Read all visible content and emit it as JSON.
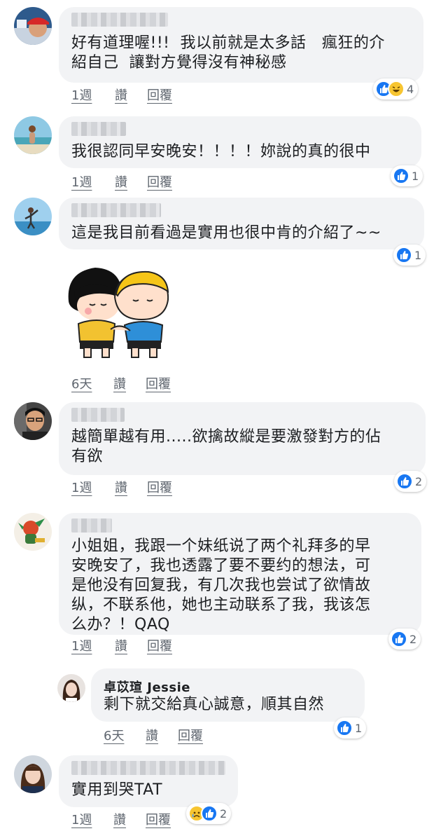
{
  "comments": [
    {
      "text": "好有道理喔!!!  我以前就是太多話   瘋狂的介\n紹自己  讓對方覺得沒有神秘感",
      "time": "1週",
      "like": "讚",
      "reply": "回覆",
      "reaction_count": "4",
      "reactions": [
        "like-icon",
        "laugh-icon"
      ]
    },
    {
      "text": "我很認同早安晚安！！！！妳說的真的很中",
      "time": "1週",
      "like": "讚",
      "reply": "回覆",
      "reaction_count": "1",
      "reactions": [
        "like-icon"
      ]
    },
    {
      "text": "這是我目前看過是實用也很中肯的介紹了~~",
      "reaction_count": "1",
      "reactions": [
        "like-icon"
      ]
    },
    {
      "sticker": "hugging-kids-sticker",
      "time": "6天",
      "like": "讚",
      "reply": "回覆"
    },
    {
      "text": "越簡單越有用.....欲擒故縱是要激發對方的佔\n有欲",
      "time": "1週",
      "like": "讚",
      "reply": "回覆",
      "reaction_count": "2",
      "reactions": [
        "like-icon"
      ]
    },
    {
      "text": "小姐姐，我跟一个妹纸说了两个礼拜多的早\n安晚安了，我也透露了要不要约的想法，可\n是他没有回复我，有几次我也尝试了欲情故\n纵，不联系他，她也主动联系了我，我该怎\n么办？！QAQ",
      "time": "1週",
      "like": "讚",
      "reply": "回覆",
      "reaction_count": "2",
      "reactions": [
        "like-icon"
      ]
    },
    {
      "name": "卓苡瑄 Jessie",
      "text": "剩下就交給真心誠意，順其自然",
      "time": "6天",
      "like": "讚",
      "reply": "回覆",
      "reaction_count": "1",
      "reactions": [
        "like-icon"
      ]
    },
    {
      "text": "實用到哭TAT",
      "time": "1週",
      "like": "讚",
      "reply": "回覆",
      "reaction_count": "2",
      "reactions": [
        "sad-icon",
        "like-icon"
      ]
    }
  ],
  "colors": {
    "bubble": "#f2f3f5",
    "like": "#1877f2",
    "meta": "#606770",
    "text": "#1c1e21"
  }
}
